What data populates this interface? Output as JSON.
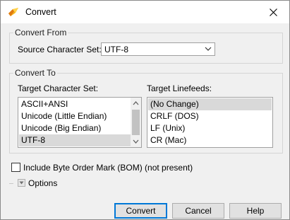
{
  "window": {
    "title": "Convert"
  },
  "convert_from": {
    "group_label": "Convert From",
    "source_label": "Source Character Set:",
    "source_value": "UTF-8"
  },
  "convert_to": {
    "group_label": "Convert To",
    "charset_label": "Target Character Set:",
    "charsets": [
      "ASCII+ANSI",
      "Unicode (Little Endian)",
      "Unicode (Big Endian)",
      "UTF-8"
    ],
    "charset_selected": "UTF-8",
    "linefeeds_label": "Target Linefeeds:",
    "linefeeds": [
      "(No Change)",
      "CRLF (DOS)",
      "LF (Unix)",
      "CR (Mac)"
    ],
    "linefeed_selected": "(No Change)"
  },
  "bom": {
    "label": "Include Byte Order Mark (BOM) (not present)",
    "checked": false
  },
  "options": {
    "label": "Options"
  },
  "buttons": {
    "convert": "Convert",
    "cancel": "Cancel",
    "help": "Help"
  }
}
